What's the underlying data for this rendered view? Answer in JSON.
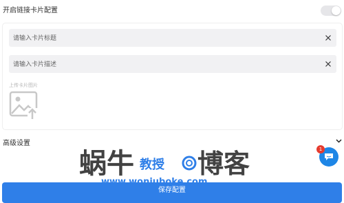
{
  "link_card": {
    "enable_label": "开启链接卡片配置",
    "enabled": false,
    "title_placeholder": "请输入卡片标题",
    "desc_placeholder": "请输入卡片描述",
    "upload_label": "上传卡片图片",
    "upload_icon": "image-upload-icon"
  },
  "advanced": {
    "label": "高级设置",
    "icon": "chevron-down-icon"
  },
  "chat_widget": {
    "badge_count": "1",
    "icon": "chat-bubble-icon"
  },
  "watermark": {
    "text_main": "蜗牛",
    "text_sub": "教授",
    "text_right": "博客",
    "url": "www.woniuboke.com"
  },
  "footer": {
    "save_label": "保存配置"
  },
  "colors": {
    "accent": "#2f7fe8",
    "badge": "#e63b2e"
  }
}
